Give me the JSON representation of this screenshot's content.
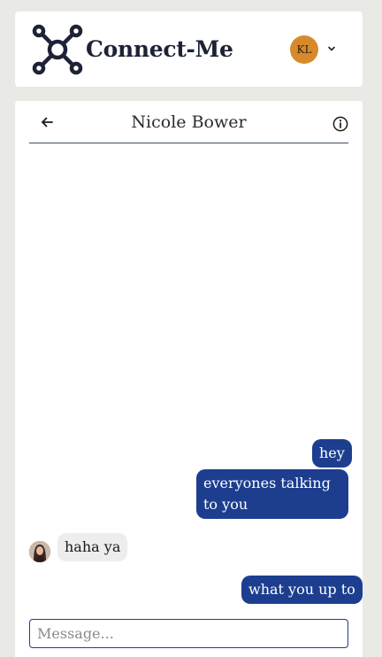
{
  "header": {
    "app_name": "Connect-Me",
    "logo_icon": "hub-network-icon",
    "user_initials": "KL",
    "menu_icon": "chevron-down-icon"
  },
  "chat": {
    "contact_name": "Nicole Bower",
    "back_icon": "arrow-left-icon",
    "info_icon": "info-circle-icon",
    "messages": [
      {
        "direction": "outgoing",
        "text": "hey"
      },
      {
        "direction": "outgoing",
        "text": "everyones talking to you"
      },
      {
        "direction": "incoming",
        "text": "haha ya"
      },
      {
        "direction": "outgoing",
        "text": "what you up to"
      }
    ],
    "input": {
      "value": "",
      "placeholder": "Message..."
    }
  },
  "colors": {
    "outgoing_bubble": "#1d3e8f",
    "incoming_bubble": "#ededed",
    "avatar_bg": "#d78a2c",
    "brand_dark": "#1e2236"
  }
}
